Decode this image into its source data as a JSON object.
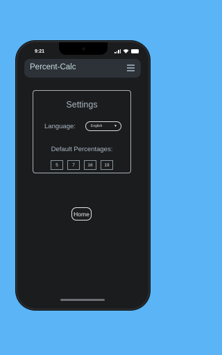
{
  "status": {
    "time": "9:21"
  },
  "navbar": {
    "brand": "Percent-Calc",
    "menu_icon": "hamburger-menu-icon"
  },
  "settings": {
    "title": "Settings",
    "language_label": "Language:",
    "language_value": "English",
    "defaults_label": "Default Percentages:",
    "percentages": [
      "5",
      "7",
      "16",
      "19"
    ]
  },
  "home_button": {
    "label": "Home"
  },
  "colors": {
    "background": "#5ab4f5",
    "app_bg": "#1b1c1e",
    "navbar_bg": "#2c3237"
  }
}
